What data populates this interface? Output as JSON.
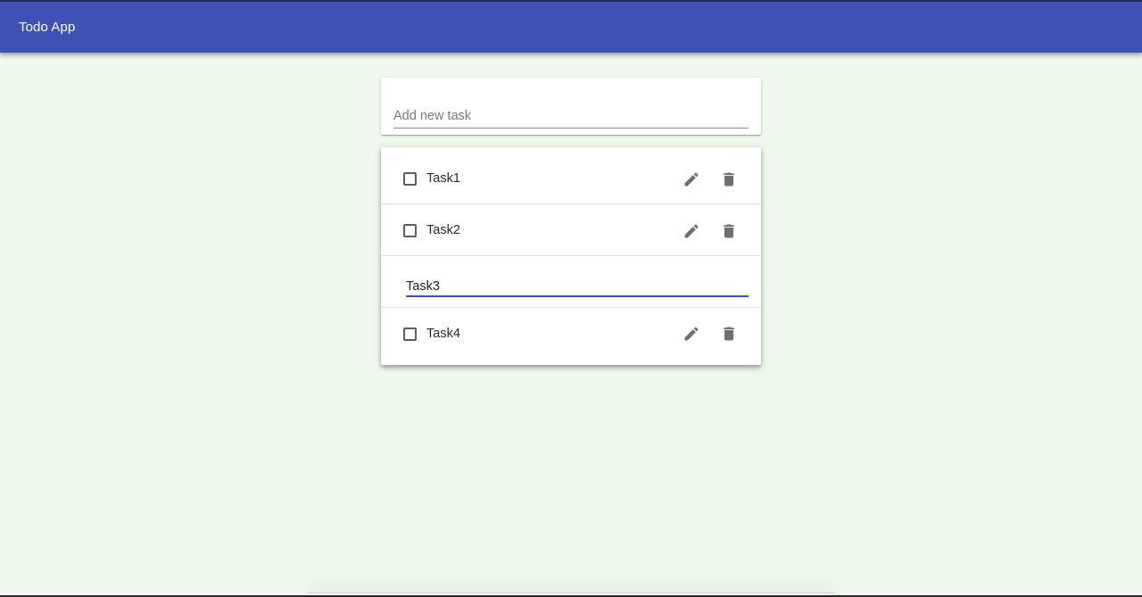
{
  "app": {
    "title": "Todo App"
  },
  "add_task": {
    "placeholder": "Add new task",
    "value": ""
  },
  "tasks": [
    {
      "label": "Task1",
      "checked": false,
      "editing": false
    },
    {
      "label": "Task2",
      "checked": false,
      "editing": false
    },
    {
      "label": "Task3",
      "checked": false,
      "editing": true,
      "edit_value": "Task3"
    },
    {
      "label": "Task4",
      "checked": false,
      "editing": false
    }
  ],
  "icons": {
    "edit": "pencil-icon",
    "delete": "trash-icon"
  },
  "colors": {
    "primary": "#3f51b5",
    "background": "#eef8ec",
    "icon": "#6f6f6f"
  }
}
